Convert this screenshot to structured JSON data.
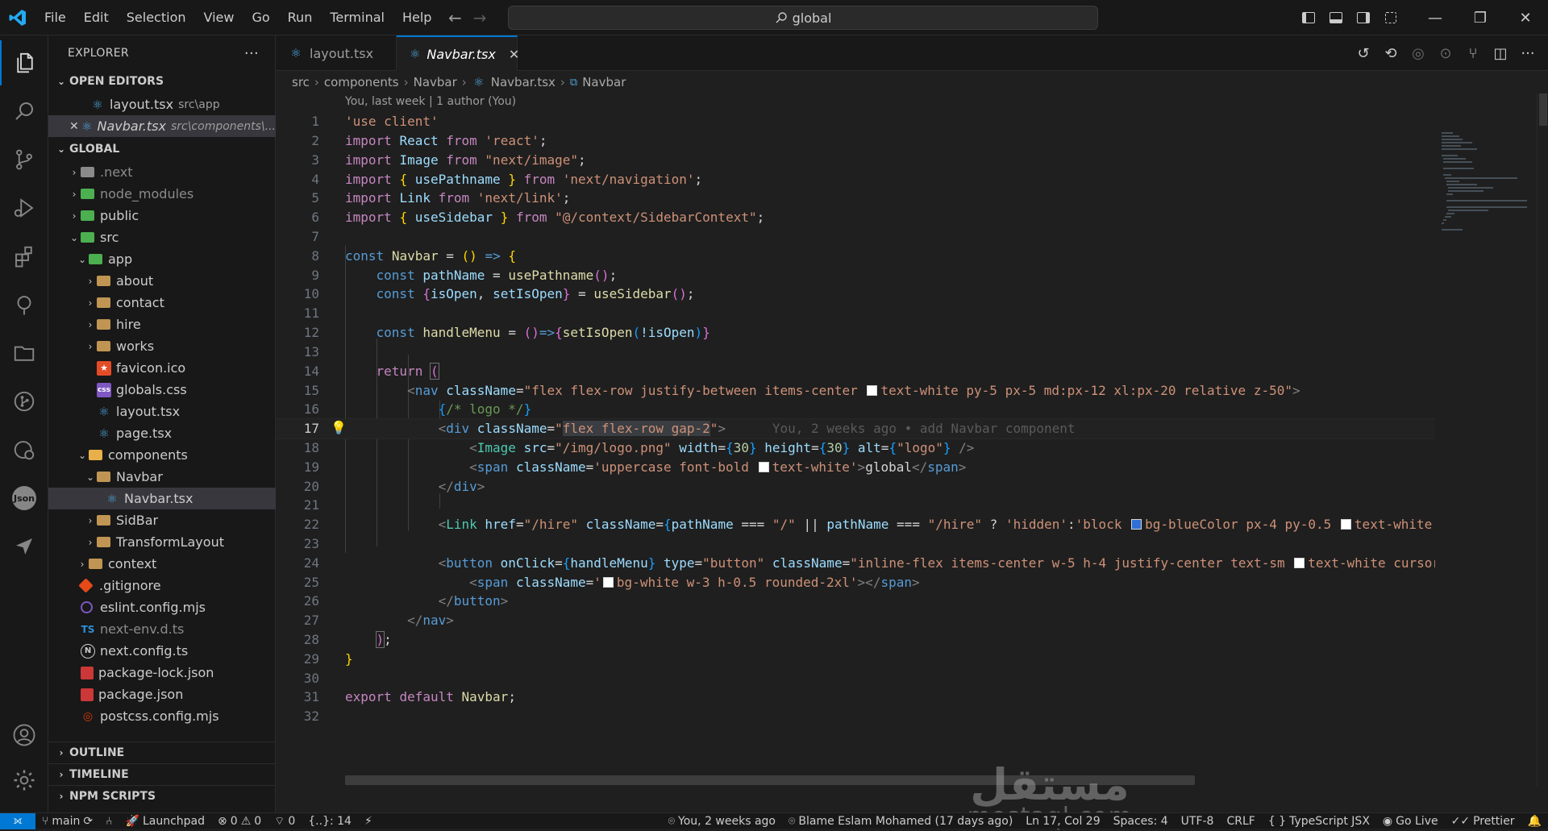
{
  "titlebar": {
    "menu": [
      "File",
      "Edit",
      "Selection",
      "View",
      "Go",
      "Run",
      "Terminal",
      "Help"
    ],
    "search_text": "global"
  },
  "activitybar": {
    "items": [
      "explorer-icon",
      "search-icon",
      "source-control-icon",
      "run-debug-icon",
      "extensions-icon",
      "tree-icon",
      "folder-icon",
      "git-graph-icon",
      "remote-icon",
      "json-icon",
      "send-icon"
    ],
    "json_label": "Json"
  },
  "sidebar": {
    "title": "EXPLORER",
    "more": "···",
    "open_editors": {
      "title": "OPEN EDITORS",
      "items": [
        {
          "name": "layout.tsx",
          "path": "src\\app"
        },
        {
          "name": "Navbar.tsx",
          "path": "src\\components\\..."
        }
      ]
    },
    "workspace": "GLOBAL",
    "tree": [
      {
        "name": ".next",
        "depth": 0,
        "kind": "folder",
        "dim": true
      },
      {
        "name": "node_modules",
        "depth": 0,
        "kind": "folder",
        "dim": true
      },
      {
        "name": "public",
        "depth": 0,
        "kind": "folder"
      },
      {
        "name": "src",
        "depth": 0,
        "kind": "folder"
      },
      {
        "name": "app",
        "depth": 1,
        "kind": "folder"
      },
      {
        "name": "about",
        "depth": 2,
        "kind": "folder"
      },
      {
        "name": "contact",
        "depth": 2,
        "kind": "folder"
      },
      {
        "name": "hire",
        "depth": 2,
        "kind": "folder"
      },
      {
        "name": "works",
        "depth": 2,
        "kind": "folder"
      },
      {
        "name": "favicon.ico",
        "depth": 2,
        "kind": "file"
      },
      {
        "name": "globals.css",
        "depth": 2,
        "kind": "file"
      },
      {
        "name": "layout.tsx",
        "depth": 2,
        "kind": "file"
      },
      {
        "name": "page.tsx",
        "depth": 2,
        "kind": "file"
      },
      {
        "name": "components",
        "depth": 1,
        "kind": "folder"
      },
      {
        "name": "Navbar",
        "depth": 2,
        "kind": "folder"
      },
      {
        "name": "Navbar.tsx",
        "depth": 3,
        "kind": "file"
      },
      {
        "name": "SidBar",
        "depth": 2,
        "kind": "folder"
      },
      {
        "name": "TransformLayout",
        "depth": 2,
        "kind": "folder"
      },
      {
        "name": "context",
        "depth": 1,
        "kind": "folder"
      },
      {
        "name": ".gitignore",
        "depth": 0,
        "kind": "file"
      },
      {
        "name": "eslint.config.mjs",
        "depth": 0,
        "kind": "file"
      },
      {
        "name": "next-env.d.ts",
        "depth": 0,
        "kind": "file",
        "dim": true
      },
      {
        "name": "next.config.ts",
        "depth": 0,
        "kind": "file"
      },
      {
        "name": "package-lock.json",
        "depth": 0,
        "kind": "file"
      },
      {
        "name": "package.json",
        "depth": 0,
        "kind": "file"
      },
      {
        "name": "postcss.config.mjs",
        "depth": 0,
        "kind": "file"
      }
    ],
    "bottom_sections": [
      "OUTLINE",
      "TIMELINE",
      "NPM SCRIPTS"
    ]
  },
  "icons": {
    "ts_badge": "TS",
    "css_badge": "css",
    "close": "✕",
    "info_n": "N"
  },
  "editor": {
    "tabs": [
      {
        "label": "layout.tsx",
        "active": false
      },
      {
        "label": "Navbar.tsx",
        "active": true
      }
    ],
    "breadcrumb": [
      "src",
      "components",
      "Navbar",
      "Navbar.tsx",
      "Navbar"
    ],
    "blame_header": "You, last week | 1 author (You)",
    "current_line": 17,
    "inline_blame": "You, 2 weeks ago • add Navbar component",
    "line_numbers": [
      "1",
      "2",
      "3",
      "4",
      "5",
      "6",
      "7",
      "8",
      "9",
      "10",
      "11",
      "12",
      "13",
      "14",
      "15",
      "16",
      "17",
      "18",
      "19",
      "20",
      "21",
      "22",
      "23",
      "24",
      "25",
      "26",
      "27",
      "28",
      "29",
      "30",
      "31",
      "32"
    ]
  },
  "code_text": {
    "l1": [
      "'use client'"
    ],
    "l2": [
      "import",
      "React",
      "from",
      "'react'",
      ";"
    ],
    "l3": [
      "import",
      "Image",
      "from",
      "\"next/image\"",
      ";"
    ],
    "l4": [
      "import",
      "{",
      "usePathname",
      "}",
      "from",
      "'next/navigation'",
      ";"
    ],
    "l5": [
      "import",
      "Link",
      "from",
      "'next/link'",
      ";"
    ],
    "l6": [
      "import",
      "{",
      "useSidebar",
      "}",
      "from",
      "\"@/context/SidebarContext\"",
      ";"
    ],
    "l8": [
      "const",
      "Navbar",
      "=",
      "()",
      "=>",
      "{"
    ],
    "l9": [
      "const",
      "pathName",
      "=",
      "usePathname",
      "()",
      ";"
    ],
    "l10": [
      "const",
      "{",
      "isOpen",
      ",",
      "setIsOpen",
      "}",
      "=",
      "useSidebar",
      "()",
      ";"
    ],
    "l12": [
      "const",
      "handleMenu",
      "=",
      "()",
      "=>",
      "{",
      "setIsOpen",
      "(",
      "!isOpen",
      ")",
      "}"
    ],
    "l14": [
      "return",
      "("
    ],
    "l15": [
      "<",
      "nav",
      "className",
      "=",
      "\"flex flex-row justify-between items-center ",
      "text-white py-5 px-5 md:px-12 xl:px-20 relative z-50\"",
      ">"
    ],
    "l16": [
      "{",
      "/* logo */",
      "}"
    ],
    "l17": [
      "<",
      "div",
      "className",
      "=",
      "\"",
      "flex flex-row gap-2",
      "\"",
      ">"
    ],
    "l18": [
      "<",
      "Image",
      "src",
      "=",
      "\"/img/logo.png\"",
      "width",
      "=",
      "{",
      "30",
      "}",
      "height",
      "=",
      "{",
      "30",
      "}",
      "alt",
      "=",
      "{",
      "\"logo\"",
      "}",
      "/>"
    ],
    "l19": [
      "<",
      "span",
      "className",
      "=",
      "'uppercase font-bold ",
      "text-white'",
      ">",
      "global",
      "</",
      "span",
      ">"
    ],
    "l20": [
      "</",
      "div",
      ">"
    ],
    "l22": [
      "<",
      "Link",
      "href",
      "=",
      "\"/hire\"",
      "className",
      "=",
      "{",
      "pathName",
      "===",
      "\"/\"",
      "||",
      "pathName",
      "===",
      "\"/hire\"",
      "?",
      "'hidden'",
      ":",
      "'block ",
      "bg-blueColor px-4 py-0.5 ",
      "text-white"
    ],
    "l24": [
      "<",
      "button",
      "onClick",
      "=",
      "{",
      "handleMenu",
      "}",
      "type",
      "=",
      "\"button\"",
      "className",
      "=",
      "\"inline-flex items-center w-5 h-4 justify-center text-sm ",
      "text-white cursor"
    ],
    "l25": [
      "<",
      "span",
      "className",
      "=",
      "'",
      "bg-white w-3 h-0.5 rounded-2xl'",
      "></",
      "span",
      ">"
    ],
    "l26": [
      "</",
      "button",
      ">"
    ],
    "l27": [
      "</",
      "nav",
      ">"
    ],
    "l28": [
      ")",
      ";"
    ],
    "l29": [
      "}"
    ],
    "l31": [
      "export",
      "default",
      "Navbar",
      ";"
    ]
  },
  "colors": {
    "accent": "#0078d4",
    "keyword": "#569cd6",
    "control": "#c586c0",
    "string": "#ce9178",
    "variable": "#9cdcfe",
    "function": "#dcdcaa",
    "type": "#4ec9b0",
    "number": "#b5cea8",
    "comment": "#6a9955"
  },
  "watermark": {
    "arabic": "مستقل",
    "latin": "mostaql.com"
  },
  "statusbar": {
    "branch": "main",
    "launchpad": "Launchpad",
    "errors": "0",
    "warnings": "0",
    "ports": "0",
    "braces": "{..}: 14",
    "blame": "You, 2 weeks ago",
    "blame_author": "Blame Eslam Mohamed (17 days ago)",
    "position": "Ln 17, Col 29",
    "spaces": "Spaces: 4",
    "encoding": "UTF-8",
    "eol": "CRLF",
    "language": "TypeScript JSX",
    "go_live": "Go Live",
    "prettier": "Prettier"
  }
}
